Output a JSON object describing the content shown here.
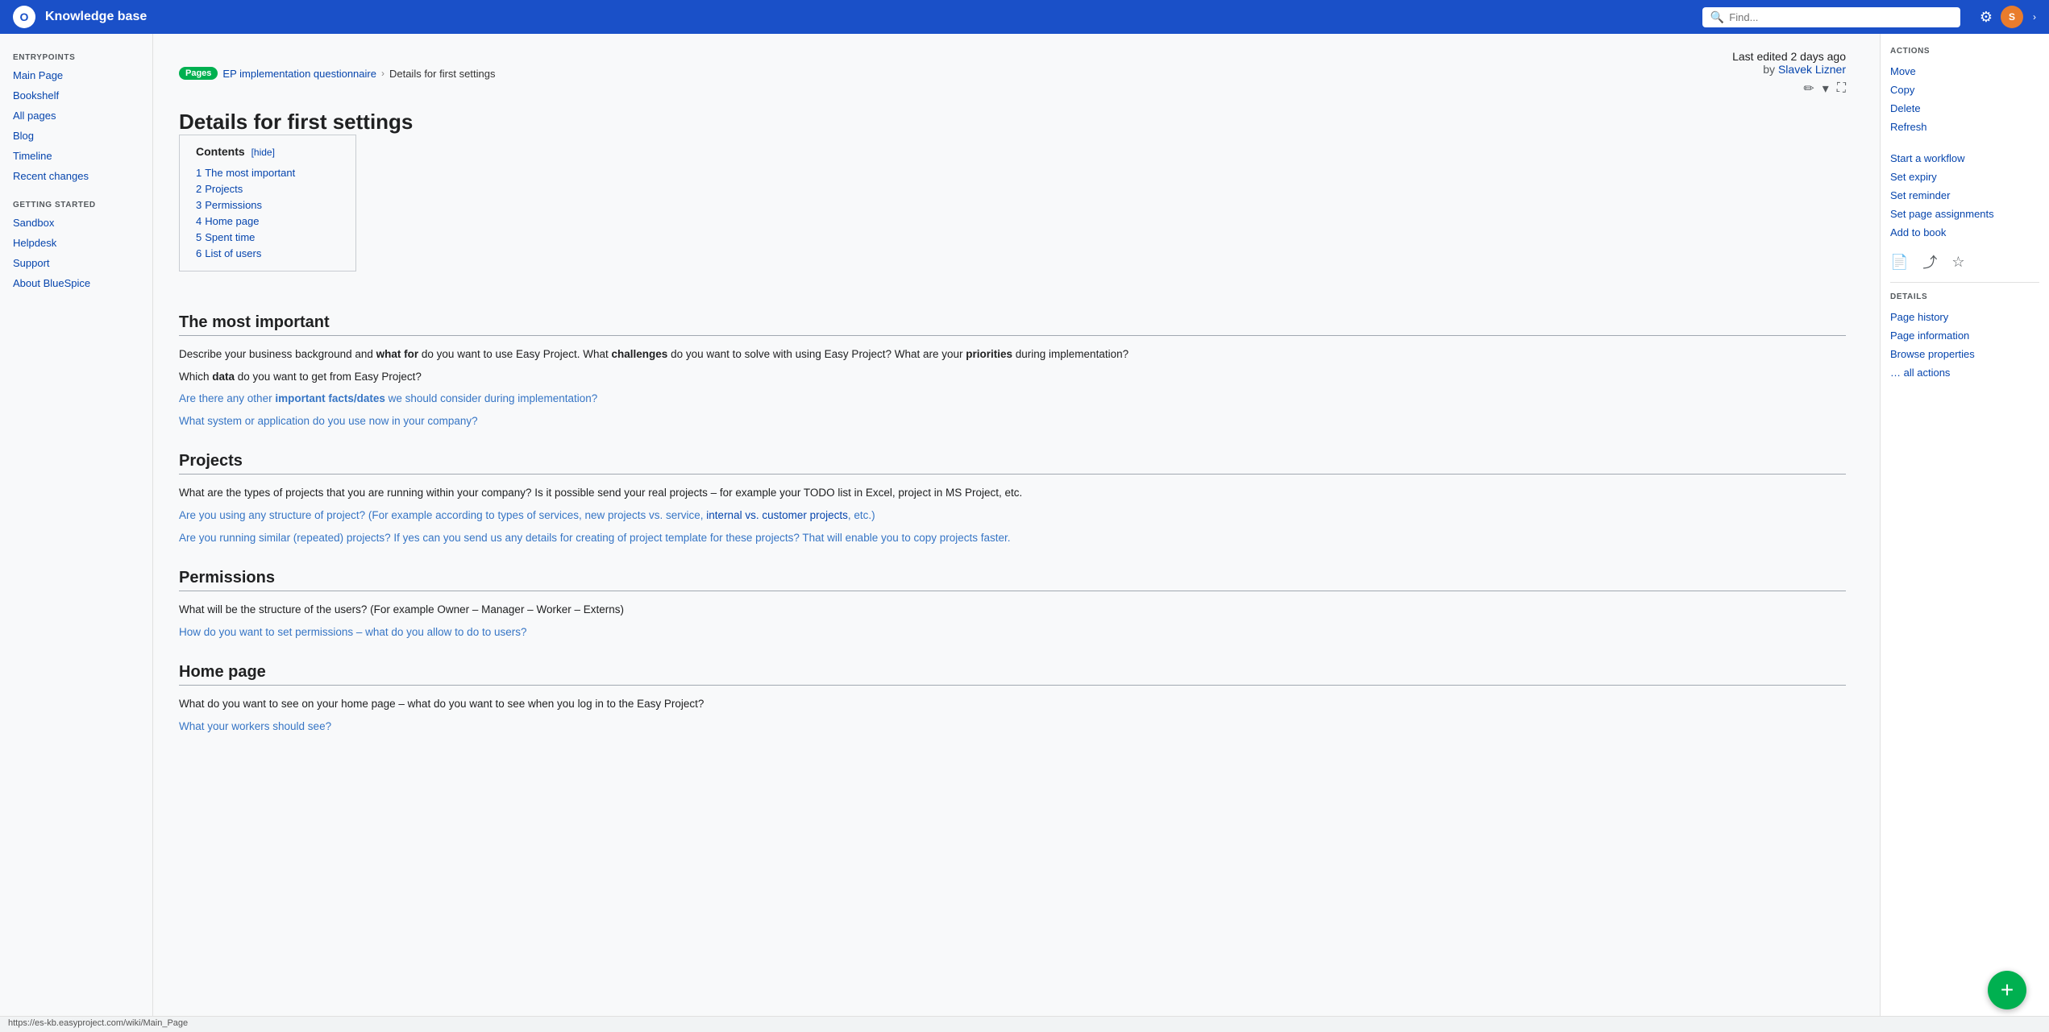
{
  "app": {
    "title": "Knowledge base",
    "logo_text": "O",
    "search_placeholder": "Find...",
    "nav_icons": [
      "⚙",
      "›"
    ]
  },
  "sidebar": {
    "sections": [
      {
        "label": "ENTRYPOINTS",
        "items": [
          {
            "id": "main-page",
            "text": "Main Page"
          },
          {
            "id": "bookshelf",
            "text": "Bookshelf"
          },
          {
            "id": "all-pages",
            "text": "All pages"
          },
          {
            "id": "blog",
            "text": "Blog"
          },
          {
            "id": "timeline",
            "text": "Timeline"
          },
          {
            "id": "recent-changes",
            "text": "Recent changes"
          }
        ]
      },
      {
        "label": "GETTING STARTED",
        "items": [
          {
            "id": "sandbox",
            "text": "Sandbox"
          },
          {
            "id": "helpdesk",
            "text": "Helpdesk"
          },
          {
            "id": "support",
            "text": "Support"
          },
          {
            "id": "about-bluespice",
            "text": "About BlueSpice"
          }
        ]
      }
    ]
  },
  "breadcrumb": {
    "pages_label": "Pages",
    "parent_page": "EP implementation questionnaire",
    "current_page": "Details for first settings"
  },
  "page": {
    "title": "Details for first settings",
    "last_edited": "Last edited 2 days ago",
    "by": "by",
    "editor": "Slavek Lizner"
  },
  "contents": {
    "title": "Contents",
    "hide_label": "[hide]",
    "items": [
      {
        "num": "1",
        "text": "The most important",
        "anchor": "#the-most-important"
      },
      {
        "num": "2",
        "text": "Projects",
        "anchor": "#projects"
      },
      {
        "num": "3",
        "text": "Permissions",
        "anchor": "#permissions"
      },
      {
        "num": "4",
        "text": "Home page",
        "anchor": "#home-page"
      },
      {
        "num": "5",
        "text": "Spent time",
        "anchor": "#spent-time"
      },
      {
        "num": "6",
        "text": "List of users",
        "anchor": "#list-of-users"
      }
    ]
  },
  "sections": [
    {
      "id": "the-most-important",
      "heading": "The most important",
      "paragraphs": [
        "Describe your business background and <b>what for</b> do you want to use Easy Project. What <b>challenges</b> do you want to solve with using Easy Project? What are your <b>priorities</b> during implementation?",
        "Which <b>data</b> do you want to get from Easy Project?",
        "Are there any other <b>important facts/dates</b> we should consider during implementation?",
        "What system or application do you use now in your company?"
      ]
    },
    {
      "id": "projects",
      "heading": "Projects",
      "paragraphs": [
        "What are the types of projects that you are running within your company? Is it possible send your real projects – for example your TODO list in Excel, project in MS Project, etc.",
        "Are you using any structure of project? (For example according to types of services, new projects vs. service, internal vs. customer projects, etc.)",
        "Are you running similar (repeated) projects? If yes can you send us any details for creating of project template for these projects? That will enable you to copy projects faster."
      ]
    },
    {
      "id": "permissions",
      "heading": "Permissions",
      "paragraphs": [
        "What will be the structure of the users? (For example Owner – Manager – Worker – Externs)",
        "How do you want to set permissions – what do you allow to do to users?"
      ]
    },
    {
      "id": "home-page",
      "heading": "Home page",
      "paragraphs": [
        "What do you want to see on your home page – what do you want to see when you log in to the Easy Project?",
        "What your workers should see?"
      ]
    }
  ],
  "actions": {
    "label": "ACTIONS",
    "items": [
      {
        "id": "move",
        "text": "Move"
      },
      {
        "id": "copy",
        "text": "Copy"
      },
      {
        "id": "delete",
        "text": "Delete"
      },
      {
        "id": "refresh",
        "text": "Refresh"
      },
      {
        "id": "start-workflow",
        "text": "Start a workflow"
      },
      {
        "id": "set-expiry",
        "text": "Set expiry"
      },
      {
        "id": "set-reminder",
        "text": "Set reminder"
      },
      {
        "id": "set-page-assignments",
        "text": "Set page assignments"
      },
      {
        "id": "add-to-book",
        "text": "Add to book"
      }
    ]
  },
  "details": {
    "label": "DETAILS",
    "items": [
      {
        "id": "page-history",
        "text": "Page history"
      },
      {
        "id": "page-information",
        "text": "Page information"
      },
      {
        "id": "browse-properties",
        "text": "Browse properties"
      },
      {
        "id": "all-actions",
        "text": "… all actions"
      }
    ]
  },
  "status_bar": {
    "url": "https://es-kb.easyproject.com/wiki/Main_Page"
  },
  "fab": {
    "label": "+"
  }
}
